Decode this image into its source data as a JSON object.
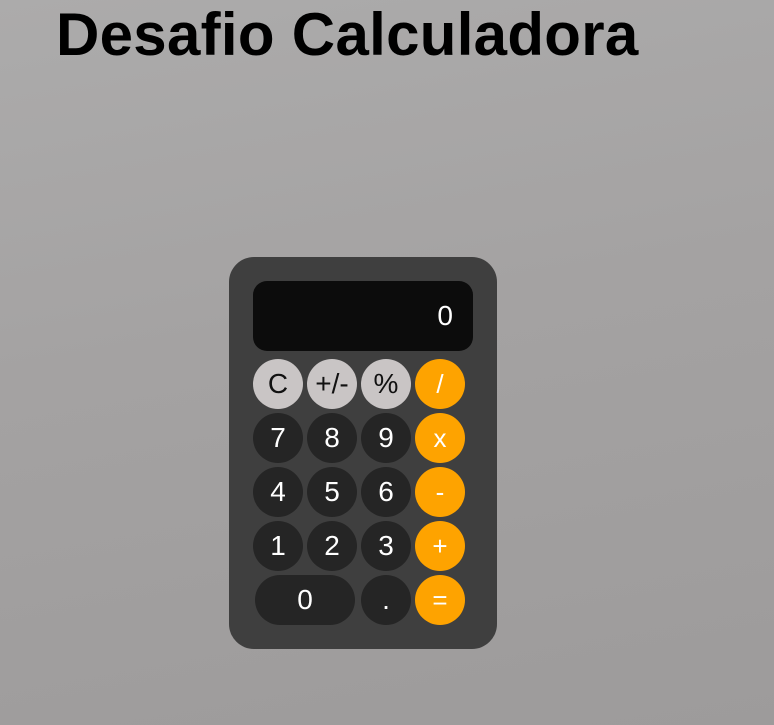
{
  "page": {
    "title": "Desafio Calculadora"
  },
  "calculator": {
    "display_value": "0",
    "buttons": {
      "clear": "C",
      "sign": "+/-",
      "percent": "%",
      "divide": "/",
      "seven": "7",
      "eight": "8",
      "nine": "9",
      "multiply": "x",
      "four": "4",
      "five": "5",
      "six": "6",
      "subtract": "-",
      "one": "1",
      "two": "2",
      "three": "3",
      "add": "+",
      "zero": "0",
      "decimal": ".",
      "equals": "="
    },
    "colors": {
      "body": "#3f3f3f",
      "display": "#0c0c0c",
      "function_key": "#c9c5c5",
      "number_key": "#252525",
      "operator_key": "#fea300"
    }
  }
}
